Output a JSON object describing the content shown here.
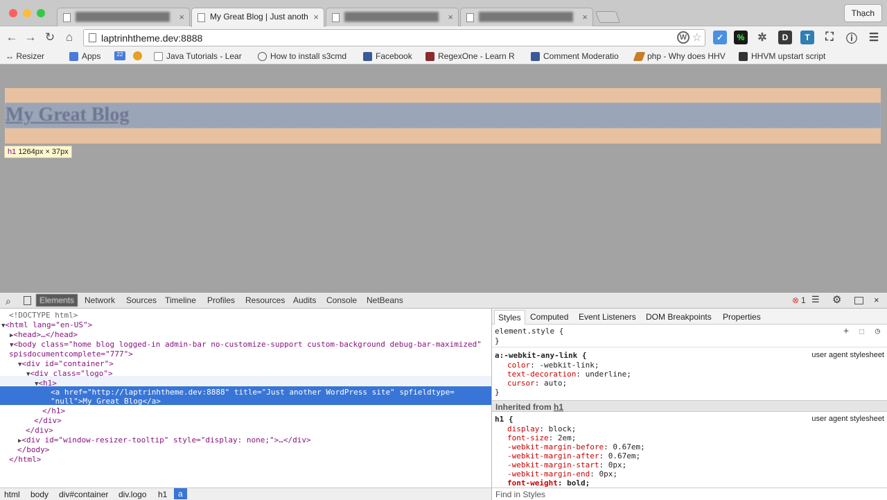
{
  "browser": {
    "tabs": [
      {
        "label": "",
        "active": false
      },
      {
        "label": "My Great Blog | Just anoth",
        "active": true
      },
      {
        "label": "",
        "active": false
      },
      {
        "label": "",
        "active": false
      }
    ],
    "user_label": "Thạch",
    "url": "laptrinhtheme.dev:8888",
    "bookmarks": [
      {
        "label": "↔ Resizer"
      },
      {
        "label": "Apps"
      },
      {
        "label": "22"
      },
      {
        "label": "Java Tutorials - Lear"
      },
      {
        "label": "How to install s3cmd"
      },
      {
        "label": "Facebook"
      },
      {
        "label": "RegexOne - Learn R"
      },
      {
        "label": "Comment Moderatio"
      },
      {
        "label": "php - Why does HHV"
      },
      {
        "label": "HHVM upstart script"
      }
    ]
  },
  "page": {
    "heading_text": "My Great Blog",
    "tooltip_tag": "h1",
    "tooltip_size": "1264px × 37px"
  },
  "devtools": {
    "tabs": [
      "Elements",
      "Network",
      "Sources",
      "Timeline",
      "Profiles",
      "Resources",
      "Audits",
      "Console",
      "NetBeans"
    ],
    "error_count": "1",
    "dom_lines": [
      "<!DOCTYPE html>",
      "<html lang=\"en-US\">",
      "<head>…</head>",
      "<body class=\"home blog logged-in admin-bar no-customize-support custom-background debug-bar-maximized\"",
      "spisdocumentcomplete=\"777\">",
      "<div id=\"container\">",
      "<div class=\"logo\">",
      "<h1>",
      "<a href=\"http://laptrinhtheme.dev:8888\" title=\"Just another WordPress site\" spfieldtype=",
      "\"null\">My Great Blog</a>",
      "</h1>",
      "</div>",
      "</div>",
      "<div id=\"window-resizer-tooltip\" style=\"display: none;\">…</div>",
      "</body>",
      "</html>"
    ],
    "breadcrumbs": [
      "html",
      "body",
      "div#container",
      "div.logo",
      "h1",
      "a"
    ],
    "styles_tabs": [
      "Styles",
      "Computed",
      "Event Listeners",
      "DOM Breakpoints",
      "Properties"
    ],
    "element_style": "element.style {",
    "close_brace": "}",
    "rule1_selector": "a:-webkit-any-link {",
    "rule1_source": "user agent stylesheet",
    "rule1_props": [
      {
        "name": "color",
        "value": "-webkit-link;"
      },
      {
        "name": "text-decoration",
        "value": "underline;"
      },
      {
        "name": "cursor",
        "value": "auto;"
      }
    ],
    "inherited_label": "Inherited from",
    "inherited_tag": "h1",
    "rule2_selector": "h1 {",
    "rule2_source": "user agent stylesheet",
    "rule2_props": [
      {
        "name": "display",
        "value": "block;"
      },
      {
        "name": "font-size",
        "value": "2em;"
      },
      {
        "name": "-webkit-margin-before",
        "value": "0.67em;"
      },
      {
        "name": "-webkit-margin-after",
        "value": "0.67em;"
      },
      {
        "name": "-webkit-margin-start",
        "value": "0px;"
      },
      {
        "name": "-webkit-margin-end",
        "value": "0px;"
      },
      {
        "name": "font-weight",
        "value": "bold;"
      }
    ],
    "find_placeholder": "Find in Styles"
  }
}
